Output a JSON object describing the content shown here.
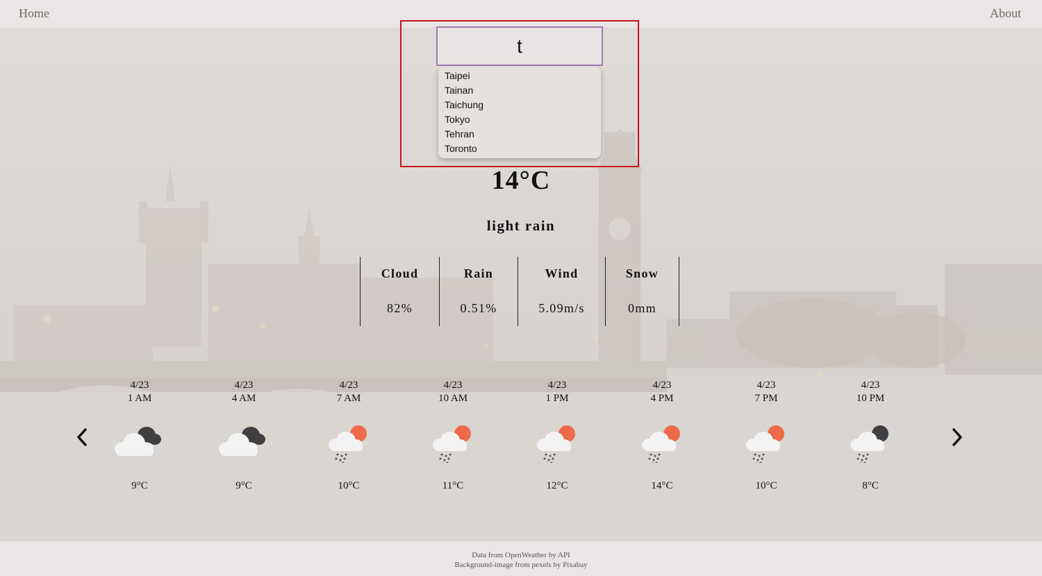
{
  "nav": {
    "home": "Home",
    "about": "About"
  },
  "search": {
    "value": "t",
    "suggestions": [
      "Taipei",
      "Tainan",
      "Taichung",
      "Tokyo",
      "Tehran",
      "Toronto"
    ]
  },
  "current": {
    "temperature": "14°C",
    "description": "light rain"
  },
  "stats": [
    {
      "label": "Cloud",
      "value": "82%"
    },
    {
      "label": "Rain",
      "value": "0.51%"
    },
    {
      "label": "Wind",
      "value": "5.09m/s"
    },
    {
      "label": "Snow",
      "value": "0mm"
    }
  ],
  "forecast": [
    {
      "date": "4/23",
      "time": "1 AM",
      "temp": "9°C",
      "icon": "night-cloudy-icon"
    },
    {
      "date": "4/23",
      "time": "4 AM",
      "temp": "9°C",
      "icon": "night-cloudy-icon"
    },
    {
      "date": "4/23",
      "time": "7 AM",
      "temp": "10°C",
      "icon": "day-rain-icon"
    },
    {
      "date": "4/23",
      "time": "10 AM",
      "temp": "11°C",
      "icon": "day-rain-icon"
    },
    {
      "date": "4/23",
      "time": "1 PM",
      "temp": "12°C",
      "icon": "day-rain-icon"
    },
    {
      "date": "4/23",
      "time": "4 PM",
      "temp": "14°C",
      "icon": "day-rain-icon"
    },
    {
      "date": "4/23",
      "time": "7 PM",
      "temp": "10°C",
      "icon": "day-rain-icon"
    },
    {
      "date": "4/23",
      "time": "10 PM",
      "temp": "8°C",
      "icon": "night-rain-icon"
    }
  ],
  "footer": {
    "line1": "Data from OpenWeather by API",
    "line2": "Background-image from pexels by Pixabay"
  },
  "colors": {
    "sun": "#ee6a4a",
    "moon": "#3f3f41",
    "cloud": "#f3f3f3",
    "highlight": "#c8121d",
    "input_border": "#a27bb0"
  }
}
